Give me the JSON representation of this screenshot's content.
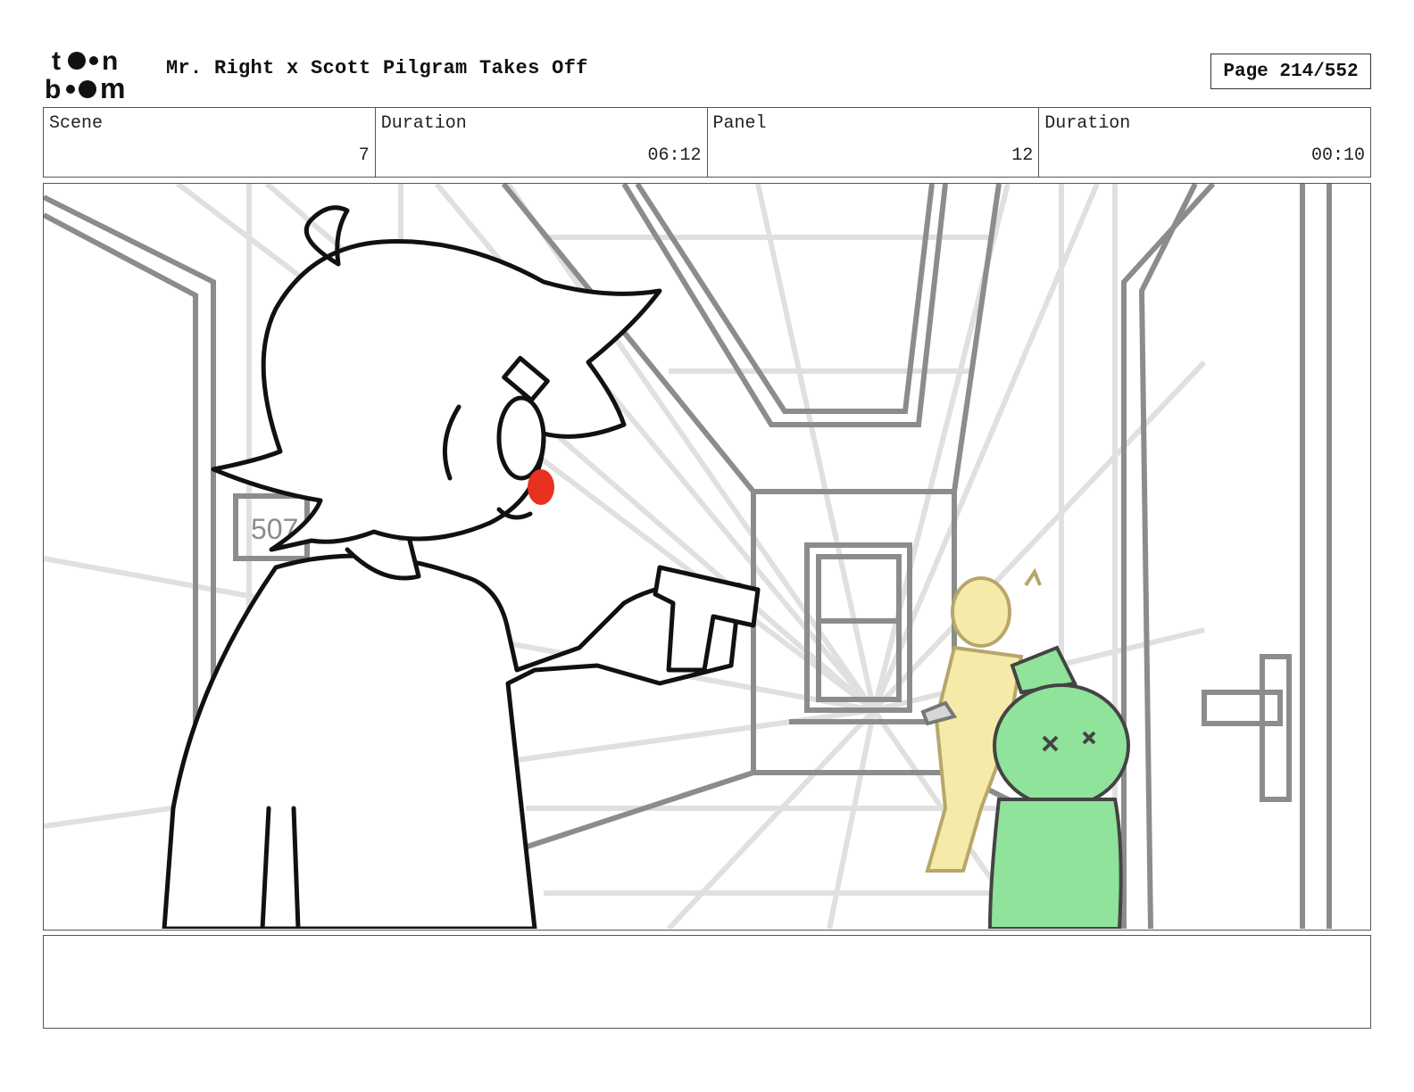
{
  "header": {
    "logo_text": "toon boom",
    "title": "Mr. Right x Scott Pilgram Takes Off",
    "page_label": "Page 214/552"
  },
  "info": [
    {
      "label": "Scene",
      "value": "7"
    },
    {
      "label": "Duration",
      "value": "06:12"
    },
    {
      "label": "Panel",
      "value": "12"
    },
    {
      "label": "Duration",
      "value": "00:10"
    }
  ],
  "panel": {
    "door_number": "507"
  },
  "notes": {
    "text": ""
  }
}
